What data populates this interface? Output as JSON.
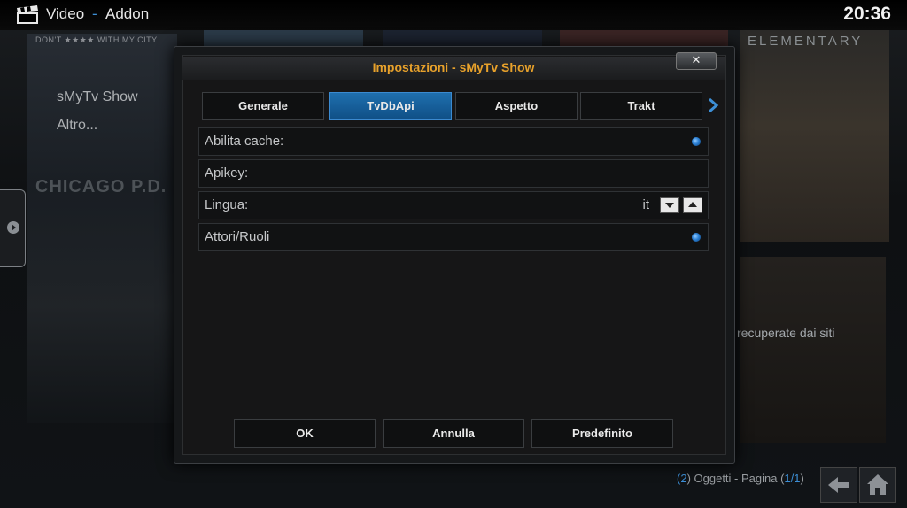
{
  "header": {
    "section": "Video",
    "separator": "-",
    "subsection": "Addon",
    "clock": "20:36"
  },
  "background": {
    "list_items": [
      "sMyTv Show",
      "Altro..."
    ],
    "poster_texts": {
      "city": "DON'T ★★★★ WITH MY CITY",
      "chicago": "CHICAGO P.D.",
      "elementary": "ELEMENTARY",
      "recuperate": "recuperate dai siti"
    },
    "footer": {
      "open_paren": "(",
      "count": "2",
      "objects_text": ") Oggetti - Pagina (",
      "page": "1/1",
      "close_paren": ")"
    }
  },
  "dialog": {
    "title": "Impostazioni - sMyTv Show",
    "close_label": "✕",
    "tabs": [
      {
        "label": "Generale",
        "active": false
      },
      {
        "label": "TvDbApi",
        "active": true
      },
      {
        "label": "Aspetto",
        "active": false
      },
      {
        "label": "Trakt",
        "active": false
      }
    ],
    "next_tab_icon": "chevron-right-icon",
    "settings": [
      {
        "label": "Abilita cache:",
        "type": "radio",
        "enabled": true
      },
      {
        "label": "Apikey:",
        "type": "text",
        "value": ""
      },
      {
        "label": "Lingua:",
        "type": "spin",
        "value": "it"
      },
      {
        "label": "Attori/Ruoli",
        "type": "radio",
        "enabled": true
      }
    ],
    "buttons": {
      "ok": "OK",
      "cancel": "Annulla",
      "default": "Predefinito"
    }
  },
  "colors": {
    "accent_blue": "#3d8fd6",
    "title_orange": "#e7a12b",
    "tab_active": "#1f6fae"
  }
}
